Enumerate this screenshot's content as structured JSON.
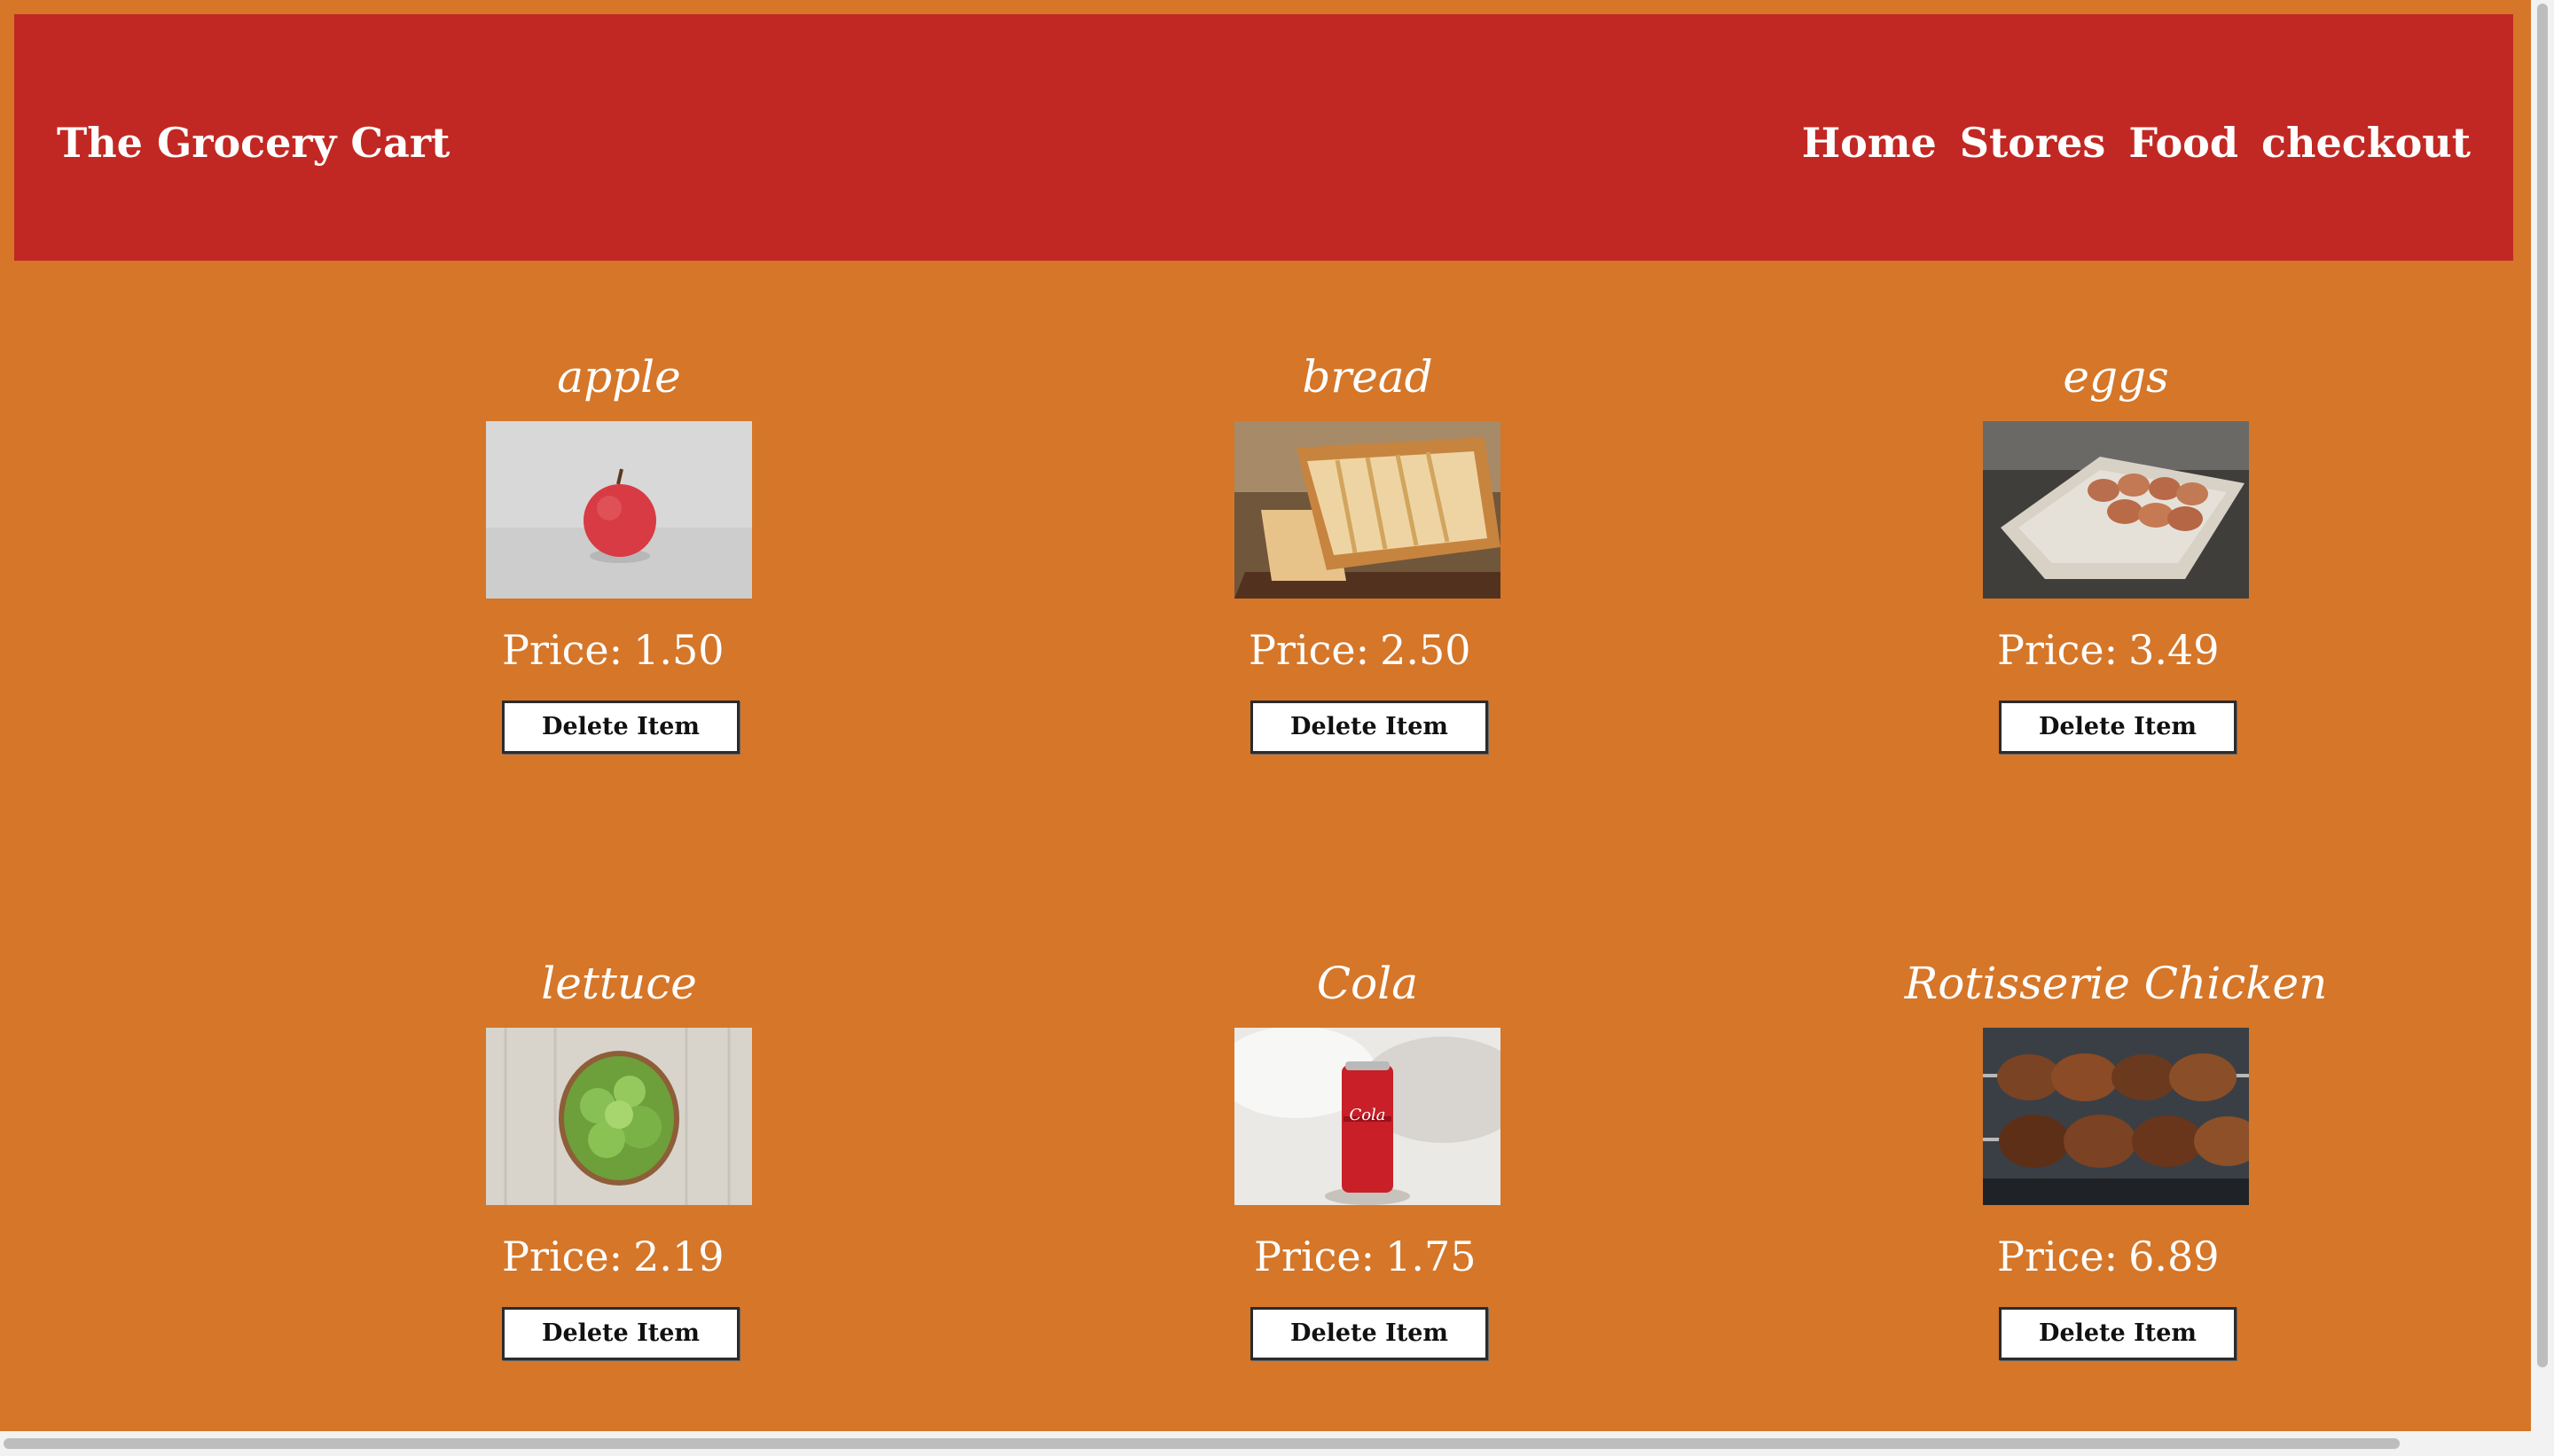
{
  "brand": {
    "title": "The Grocery Cart"
  },
  "nav": {
    "items": [
      "Home",
      "Stores",
      "Food",
      "checkout"
    ]
  },
  "cart": {
    "price_label": "Price:",
    "delete_label": "Delete Item",
    "items": [
      {
        "name": "apple",
        "price": "1.50",
        "image": "apple-photo"
      },
      {
        "name": "bread",
        "price": "2.50",
        "image": "bread-photo"
      },
      {
        "name": "eggs",
        "price": "3.49",
        "image": "eggs-photo"
      },
      {
        "name": "lettuce",
        "price": "2.19",
        "image": "lettuce-photo"
      },
      {
        "name": "Cola",
        "price": "1.75",
        "image": "cola-photo"
      },
      {
        "name": "Rotisserie Chicken",
        "price": "6.89",
        "image": "chicken-photo"
      }
    ]
  },
  "colors": {
    "page_background": "#d57629",
    "header_background": "#c22823",
    "text": "#ffffff",
    "button_background": "#ffffff",
    "button_border": "#2b2b2b"
  }
}
